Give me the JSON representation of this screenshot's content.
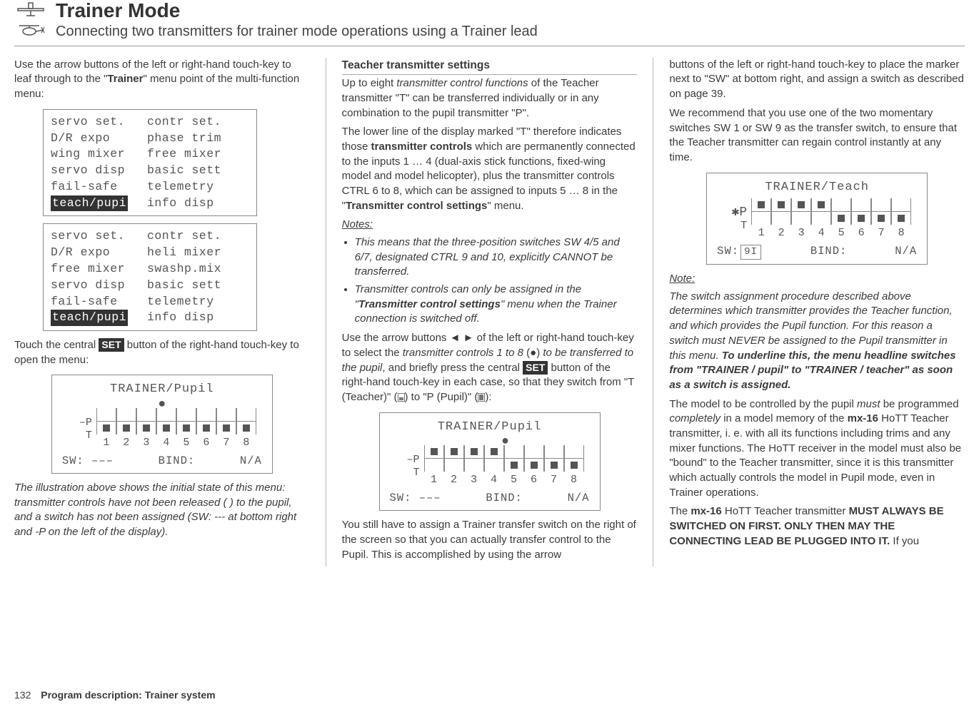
{
  "header": {
    "title": "Trainer Mode",
    "subtitle": "Connecting two transmitters for trainer mode operations using a Trainer lead"
  },
  "col1": {
    "p1a": "Use the arrow buttons of the left or right-hand touch-key to leaf through to the \"",
    "p1b": "Trainer",
    "p1c": "\" menu point of the multi-function menu:",
    "menu1": {
      "r1l": "servo set.",
      "r1r": "contr set.",
      "r2l": "D/R expo",
      "r2r": "phase trim",
      "r3l": "wing mixer",
      "r3r": "free mixer",
      "r4l": "servo disp",
      "r4r": "basic sett",
      "r5l": "fail-safe",
      "r5r": "telemetry",
      "r6l": "teach/pupi",
      "r6r": "info disp"
    },
    "menu2": {
      "r1l": "servo set.",
      "r1r": "contr set.",
      "r2l": "D/R expo",
      "r2r": "heli mixer",
      "r3l": "free mixer",
      "r3r": "swashp.mix",
      "r4l": "servo disp",
      "r4r": "basic sett",
      "r5l": "fail-safe",
      "r5r": "telemetry",
      "r6l": "teach/pupi",
      "r6r": "info disp"
    },
    "p2a": "Touch the central ",
    "p2b": "SET",
    "p2c": " button of the right-hand touch-key to open the menu:",
    "lcd1": {
      "title": "TRAINER/Pupil",
      "left_top": "–P",
      "left_bot": "T",
      "nums": [
        "1",
        "2",
        "3",
        "4",
        "5",
        "6",
        "7",
        "8"
      ],
      "sw": "SW: –––",
      "bind": "BIND:",
      "na": "N/A"
    },
    "caption": "The illustration above shows the initial state of this menu: transmitter controls have not been released ( ) to the pupil, and a switch has not been assigned (SW: --- at bottom right and -P on the left of the display)."
  },
  "col2": {
    "h1": "Teacher transmitter settings",
    "p1a": "Up to eight ",
    "p1b": "transmitter control functions",
    "p1c": " of the Teacher transmitter \"T\" can be transferred individually or in any combination to the pupil transmitter \"P\".",
    "p2a": "The lower line of the display marked \"T\" therefore indicates those ",
    "p2b": "transmitter controls",
    "p2c": " which are permanently connected to the inputs 1 … 4 (dual-axis stick functions, fixed-wing model and model helicopter), plus the transmitter controls CTRL 6 to 8, which can be assigned to inputs 5 … 8 in the \"",
    "p2d": "Transmitter control settings",
    "p2e": "\" menu.",
    "notes_h": "Notes:",
    "note1": "This means that the three-position switches SW 4/5 and 6/7, designated CTRL 9 and 10, explicitly CANNOT be transferred.",
    "note2a": "Transmitter controls can only be assigned in the \"",
    "note2b": "Transmitter control settings",
    "note2c": "\" menu when the Trainer connection is switched off.",
    "p3a": "Use the arrow buttons ◄ ► of the left or right-hand touch-key to select the ",
    "p3b": "transmitter controls 1 to 8",
    "p3c": " (●) ",
    "p3d": "to be transferred to the pupil",
    "p3e": ", and briefly press the central ",
    "p3f": "SET",
    "p3g": " button of the right-hand touch-key in each case, so that they switch from \"T (Teacher)\" (",
    "p3h": ") to \"P (Pupil)\" (",
    "p3i": "):",
    "lcd2": {
      "title": "TRAINER/Pupil",
      "left_top": "–P",
      "left_bot": "T",
      "nums": [
        "1",
        "2",
        "3",
        "4",
        "5",
        "6",
        "7",
        "8"
      ],
      "sw": "SW: –––",
      "bind": "BIND:",
      "na": "N/A"
    },
    "p4": "You still have to assign a Trainer transfer switch on the right of the screen so that you can actually transfer control to the Pupil. This is accomplished by using the arrow"
  },
  "col3": {
    "p1": "buttons of the left or right-hand touch-key to place the marker next to \"SW\" at bottom right, and assign a switch as described on page 39.",
    "p2": "We recommend that you use one of the two momentary switches SW 1 or SW 9 as the transfer switch, to ensure that the Teacher transmitter can regain control instantly at any time.",
    "lcd3": {
      "title": "TRAINER/Teach",
      "left_top": "✱P",
      "left_bot": "T",
      "nums": [
        "1",
        "2",
        "3",
        "4",
        "5",
        "6",
        "7",
        "8"
      ],
      "sw": "SW:",
      "swbox": "9I",
      "bind": "BIND:",
      "na": "N/A"
    },
    "note_h": "Note:",
    "note_a": "The switch assignment procedure described above determines which transmitter provides the Teacher function, and which provides the Pupil function. For this reason a switch must NEVER be assigned to the Pupil transmitter in this menu. ",
    "note_b": "To underline this, the menu headline switches from \"TRAINER / pupil\" to \"TRAINER / teacher\" as soon as a switch is assigned.",
    "p3a": "The model to be controlled by the pupil ",
    "p3b": "must",
    "p3c": " be programmed ",
    "p3d": "completely",
    "p3e": " in a model memory of the ",
    "p3f": "mx-16",
    "p3g": " HoTT Teacher transmitter, i. e. with all its functions including trims and any mixer functions. The HoTT receiver in the model must also be \"bound\" to the Teacher transmitter, since it is this transmitter which actually controls the model in Pupil mode, even in Trainer operations.",
    "p4a": "The ",
    "p4b": "mx-16",
    "p4c": " HoTT Teacher transmitter ",
    "p4d": "MUST ALWAYS BE SWITCHED ON FIRST. ONLY THEN MAY THE CONNECTING LEAD BE PLUGGED INTO IT.",
    "p4e": " If you"
  },
  "footer": {
    "page": "132",
    "text": "Program description: Trainer system"
  }
}
